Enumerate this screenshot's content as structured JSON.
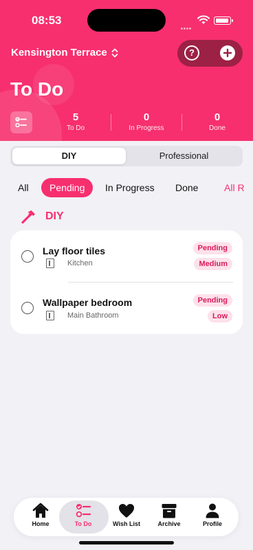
{
  "status": {
    "time": "08:53"
  },
  "header": {
    "location": "Kensington Terrace",
    "title": "To Do",
    "help_label": "?",
    "stats": [
      {
        "value": "5",
        "label": "To Do"
      },
      {
        "value": "0",
        "label": "In Progress"
      },
      {
        "value": "0",
        "label": "Done"
      }
    ]
  },
  "segments": {
    "active": "DIY",
    "inactive": "Professional"
  },
  "filters": [
    "All",
    "Pending",
    "In Progress",
    "Done",
    "All R"
  ],
  "section": {
    "title": "DIY"
  },
  "tasks": [
    {
      "title": "Lay floor tiles",
      "room": "Kitchen",
      "status": "Pending",
      "priority": "Medium"
    },
    {
      "title": "Wallpaper bedroom",
      "room": "Main Bathroom",
      "status": "Pending",
      "priority": "Low"
    }
  ],
  "tabbar": {
    "tabs": [
      {
        "label": "Home",
        "icon": "home-icon"
      },
      {
        "label": "To Do",
        "icon": "checklist-icon"
      },
      {
        "label": "Wish List",
        "icon": "heart-icon"
      },
      {
        "label": "Archive",
        "icon": "archive-icon"
      },
      {
        "label": "Profile",
        "icon": "person-icon"
      }
    ]
  },
  "colors": {
    "accent": "#f72f6e",
    "accent_dark": "#9d2145",
    "badge_bg": "#fde1ea",
    "background": "#f2f1f6"
  }
}
